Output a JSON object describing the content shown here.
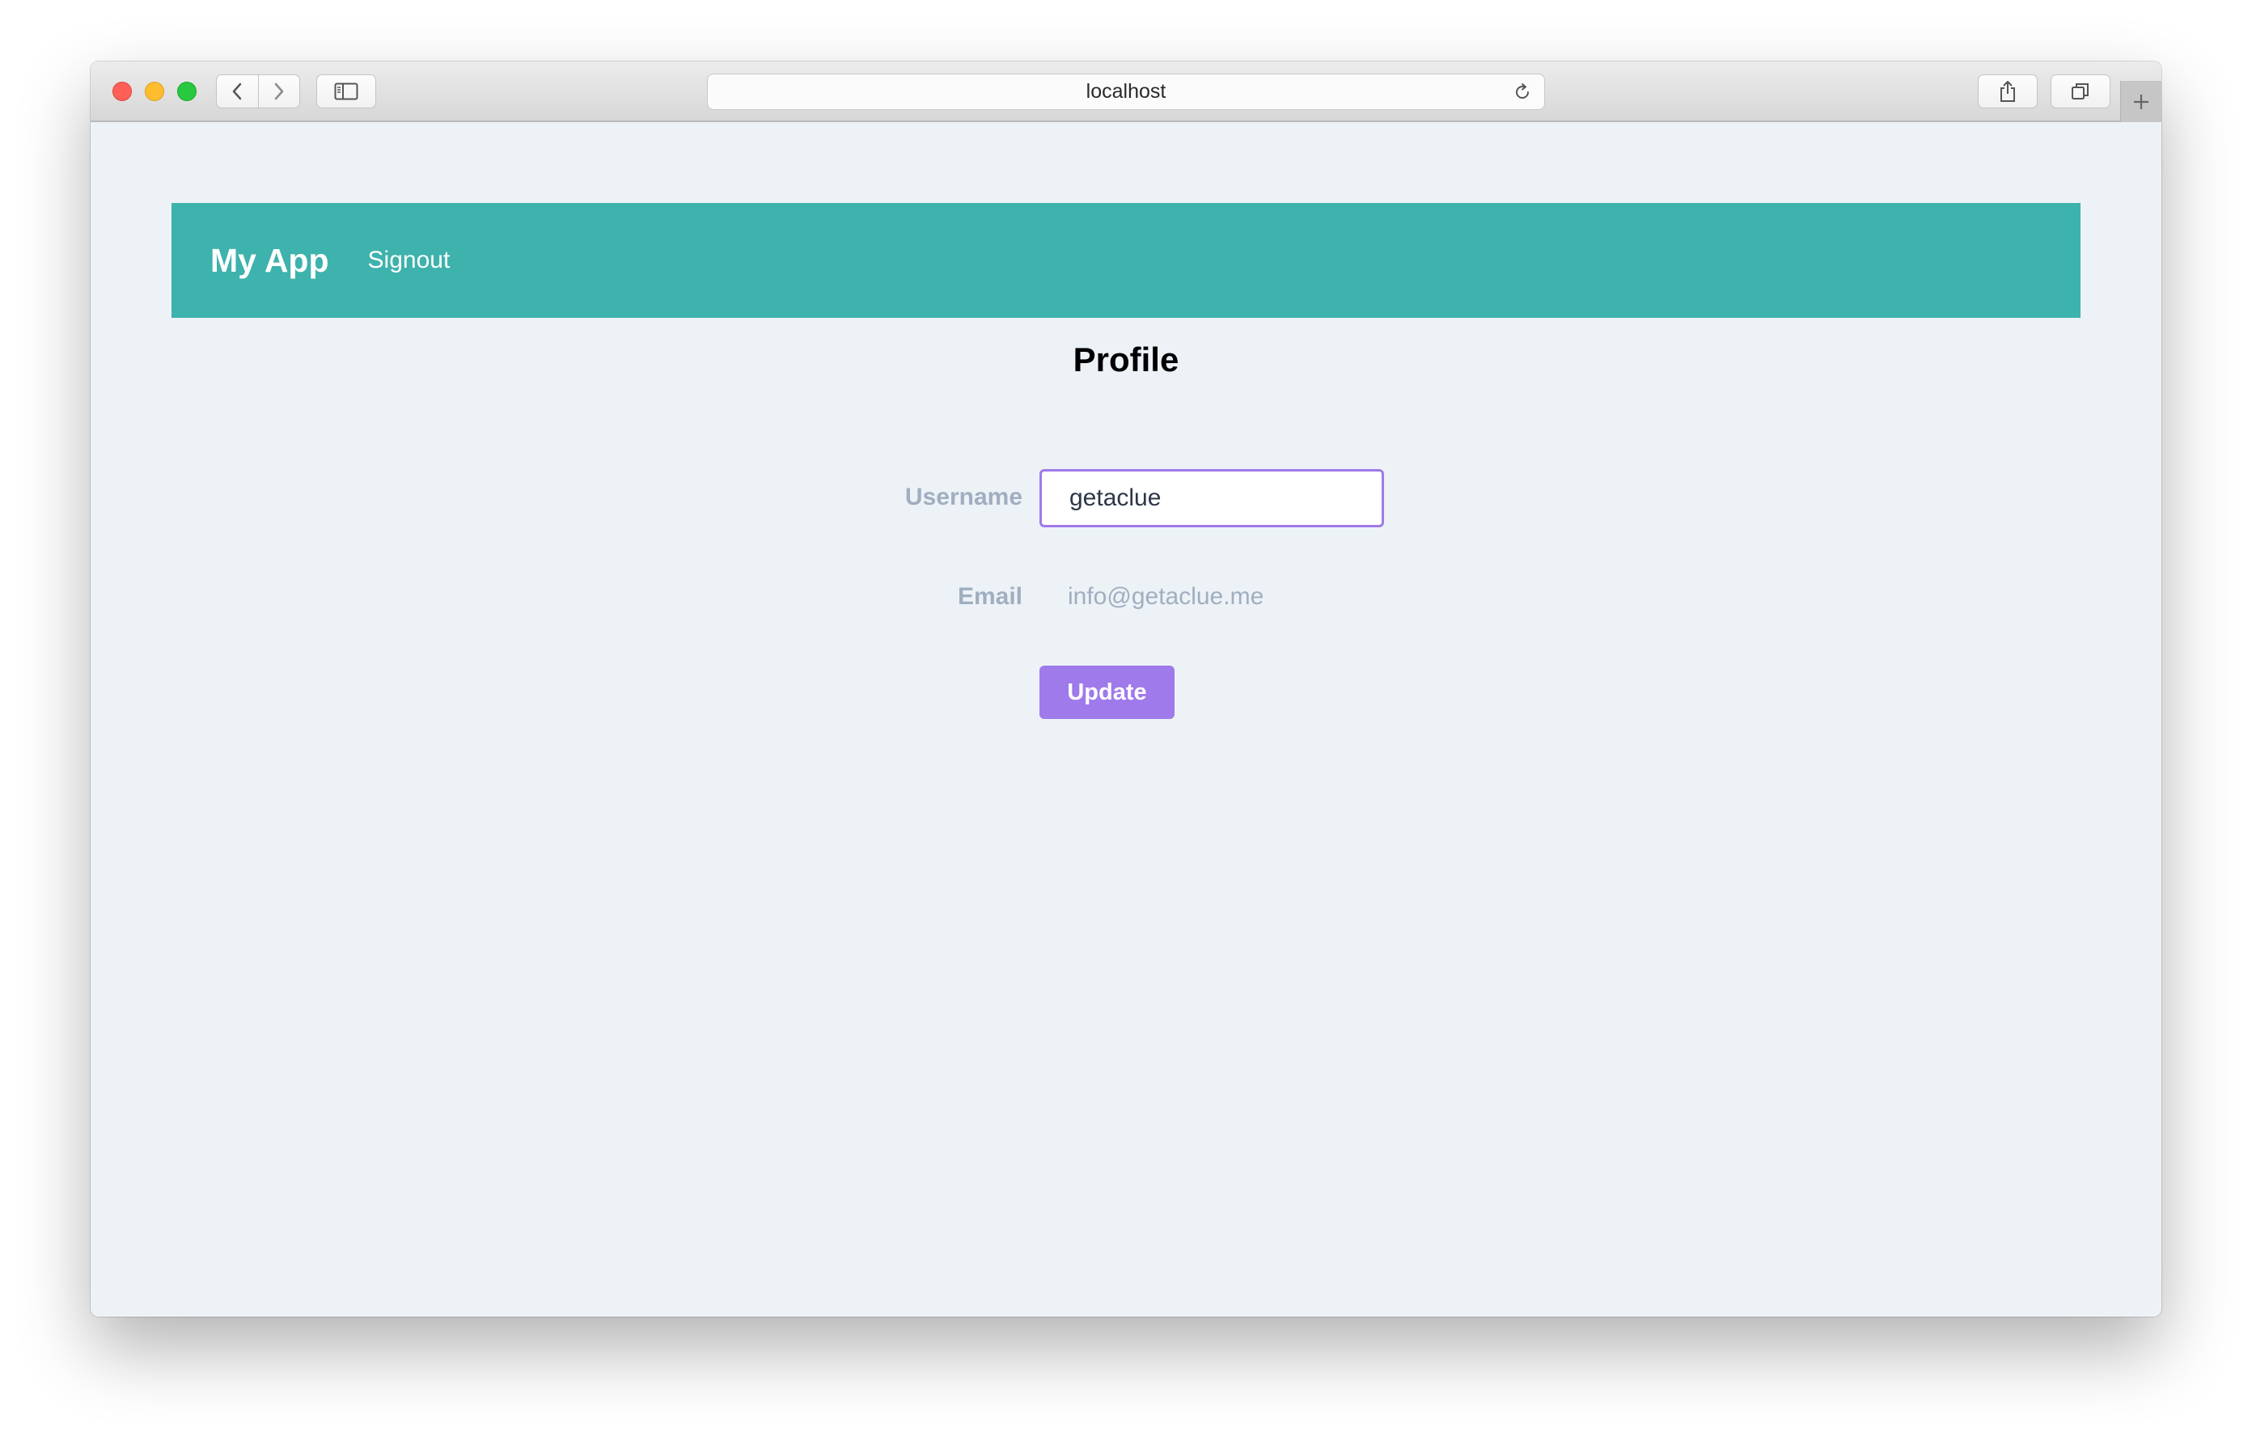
{
  "browser": {
    "url": "localhost",
    "icons": {
      "back": "chevron-left-icon",
      "forward": "chevron-right-icon",
      "sidebar": "sidebar-icon",
      "reload": "reload-icon",
      "share": "share-icon",
      "tabs": "tabs-overview-icon",
      "new_tab": "plus-icon"
    }
  },
  "app": {
    "brand": "My App",
    "nav": {
      "signout_label": "Signout"
    },
    "colors": {
      "header_bg": "#3eb2ac",
      "accent": "#9f7aea",
      "page_bg": "#edf2f7",
      "muted_text": "#a0aec0"
    }
  },
  "profile": {
    "title": "Profile",
    "username_label": "Username",
    "username_value": "getaclue",
    "email_label": "Email",
    "email_value": "info@getaclue.me",
    "update_label": "Update"
  }
}
